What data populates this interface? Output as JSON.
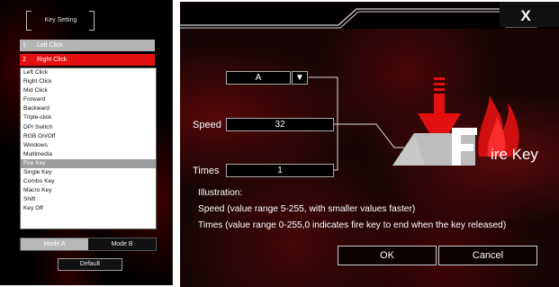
{
  "key_setting": {
    "title": "Key Setting",
    "buttons": [
      {
        "num": "1",
        "label": "Left Click"
      },
      {
        "num": "2",
        "label": "Right Click"
      }
    ],
    "functions": [
      "Left Click",
      "Right Click",
      "Mid Click",
      "Forward",
      "Backward",
      "Triple-click",
      "DPI Switch",
      "RGB On/Off",
      "Windows",
      "Multimedia",
      "Fire Key",
      "Single Key",
      "Combo Key",
      "Macro Key",
      "Shift",
      "Key Off"
    ],
    "selected_function": "Fire Key",
    "mode_a": "Mode A",
    "mode_b": "Mode B",
    "default_label": "Default"
  },
  "fire_key": {
    "close_label": "X",
    "key_value": "A",
    "dropdown_glyph": "▼",
    "speed_label": "Speed",
    "speed_value": "32",
    "times_label": "Times",
    "times_value": "1",
    "illustration_title": "Illustration:",
    "illustration_speed": "Speed (value range 5-255, with smaller values faster)",
    "illustration_times": "Times (value range 0-255,0 indicates fire key to end when the key released)",
    "ok_label": "OK",
    "cancel_label": "Cancel",
    "logo_text": "ire Key"
  },
  "colors": {
    "accent_red": "#e41010",
    "selected_gray": "#9c9c9c",
    "panel_bg": "#000000"
  }
}
